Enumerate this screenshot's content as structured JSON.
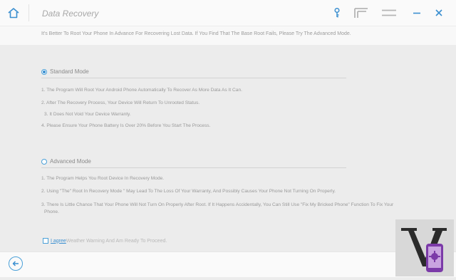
{
  "header": {
    "title": "Data Recovery",
    "icons": [
      "home-icon",
      "key-icon",
      "feedback-icon",
      "menu-icon",
      "minimize-icon",
      "close-icon"
    ]
  },
  "notice": "It's Better To Root Your Phone In Advance For Recovering Lost Data. If You Find That The Base Root Fails, Please Try The Advanced Mode.",
  "standard": {
    "label": "Standard Mode",
    "selected": true,
    "items": [
      "1. The Program Will Root Your Android Phone Automatically To Recover As More Data As It Can.",
      "2. After The Recovery Process, Your Device Will Return To Unrooted Status.",
      "3. It Does Not Void Your Device Warranty.",
      "4. Please Ensure Your Phone Battery Is Over 20% Before You Start The Process."
    ]
  },
  "advanced": {
    "label": "Advanced Mode",
    "selected": false,
    "items": [
      "1. The Program Helps You Root Device In Recovery Mode.",
      "2. Using \"The\" Root In Recovery Mode \" May Lead To The Loss Of Your Warranty, And Possibly Causes Your Phone Not Turning On Properly.",
      "3. There Is Little Chance That Your Phone Will Not Turn On Properly After Root. If It Happens Accidentally, You Can Still Use \"Fix My Bricked Phone\" Function To Fix Your",
      "Phone."
    ]
  },
  "agree": {
    "link": "I agree",
    "text": " Weather Warning And Am Ready To Proceed."
  },
  "footer": {
    "back_icon": "back-arrow-icon"
  },
  "colors": {
    "accent": "#3b8fd0",
    "background": "#ececec",
    "bar": "#fafafa"
  }
}
